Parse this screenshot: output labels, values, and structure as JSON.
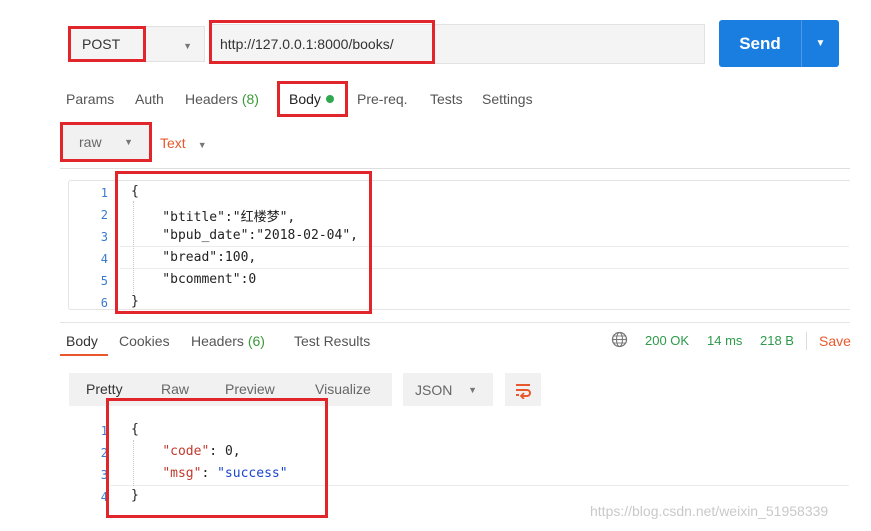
{
  "request": {
    "method": "POST",
    "url": "http://127.0.0.1:8000/books/",
    "send_label": "Send"
  },
  "request_tabs": [
    {
      "label": "Params"
    },
    {
      "label": "Auth"
    },
    {
      "label": "Headers",
      "count": "(8)"
    },
    {
      "label": "Body"
    },
    {
      "label": "Pre-req."
    },
    {
      "label": "Tests"
    },
    {
      "label": "Settings"
    }
  ],
  "body_mode": {
    "type": "raw",
    "format": "Text"
  },
  "request_body": {
    "line_numbers": [
      "1",
      "2",
      "3",
      "4",
      "5",
      "6"
    ],
    "lines": [
      "{",
      "    \"btitle\":\"红楼梦\",",
      "    \"bpub_date\":\"2018-02-04\",",
      "    \"bread\":100,",
      "    \"bcomment\":0",
      "}"
    ]
  },
  "response_tabs": [
    {
      "label": "Body"
    },
    {
      "label": "Cookies"
    },
    {
      "label": "Headers",
      "count": "(6)"
    },
    {
      "label": "Test Results"
    }
  ],
  "response_status": {
    "status": "200 OK",
    "time": "14 ms",
    "size": "218 B",
    "save_label": "Save"
  },
  "view_options": [
    "Pretty",
    "Raw",
    "Preview",
    "Visualize"
  ],
  "format_select": "JSON",
  "response_body": {
    "line_numbers": [
      "1",
      "2",
      "3",
      "4"
    ],
    "open_brace": "{",
    "close_brace": "}",
    "code_key": "\"code\"",
    "code_value": "0",
    "msg_key": "\"msg\"",
    "msg_value": "\"success\""
  },
  "watermark": "https://blog.csdn.net/weixin_51958339",
  "colors": {
    "accent": "#e8582c",
    "send_button": "#1a7de0",
    "annotation_box": "#e0262b",
    "status_ok": "#2e9a4a"
  },
  "icons": {
    "globe": "globe-icon",
    "wrap": "wrap-lines-icon"
  }
}
